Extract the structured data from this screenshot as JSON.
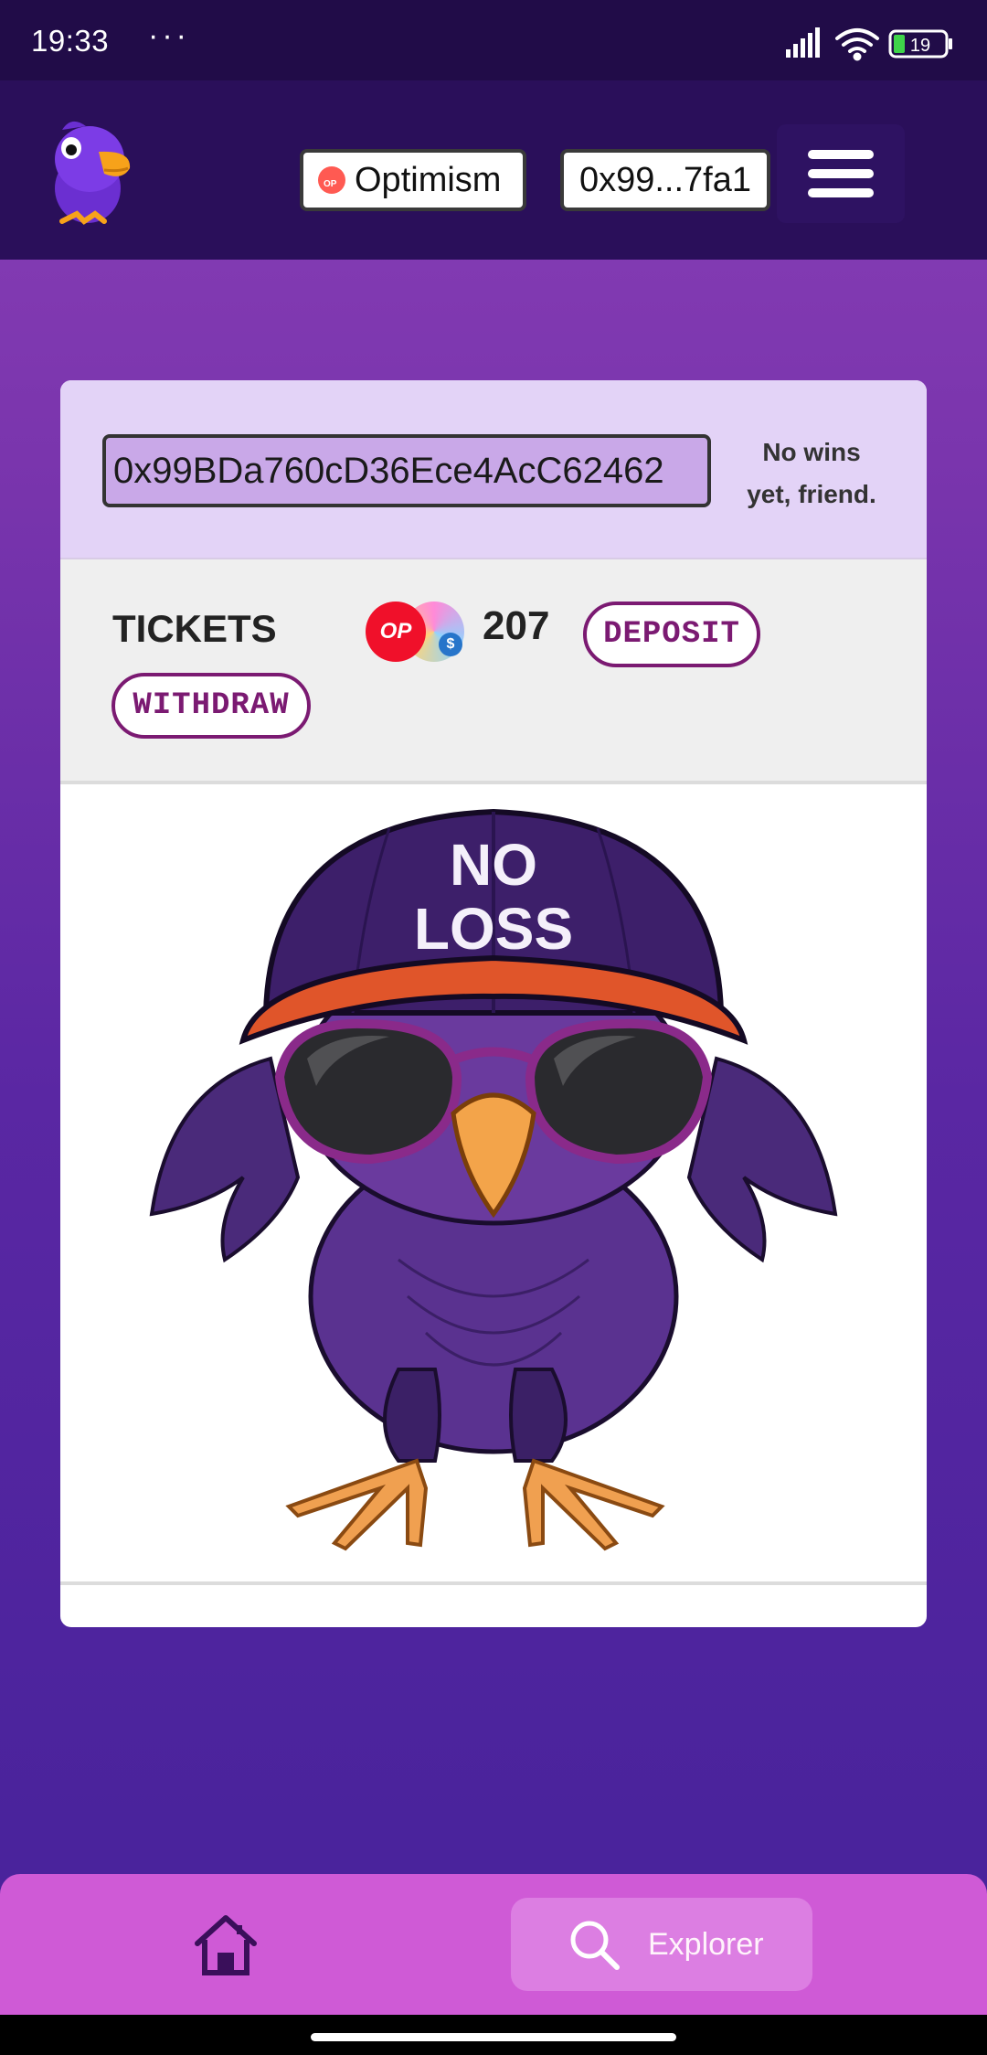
{
  "status_bar": {
    "time": "19:33",
    "dots": "···",
    "battery": "19",
    "icons": [
      "signal-icon",
      "wifi-icon",
      "battery-icon"
    ]
  },
  "header": {
    "logo": "parrot-logo",
    "network_label": "Optimism",
    "network_icon_text": "OP",
    "account_label": "0x99...7fa1",
    "menu_icon": "hamburger-icon"
  },
  "card": {
    "address_value": "0x99BDa760cD36Ece4AcC62462",
    "no_wins_line1": "No wins",
    "no_wins_line2": "yet, friend.",
    "tickets_label": "TICKETS",
    "token_op_text": "OP",
    "ticket_count": "207",
    "deposit_label": "DEPOSIT",
    "withdraw_label": "WITHDRAW",
    "artwork": {
      "cap_line1": "NO",
      "cap_line2": "LOSS"
    }
  },
  "bottom_nav": {
    "home_icon": "home-icon",
    "explorer_label": "Explorer",
    "explorer_icon": "search-icon"
  },
  "colors": {
    "accent": "#7b1a72",
    "header_bg": "#2a0f5a",
    "nav_bg": "#cf5ad6",
    "op_red": "#f0102a"
  }
}
